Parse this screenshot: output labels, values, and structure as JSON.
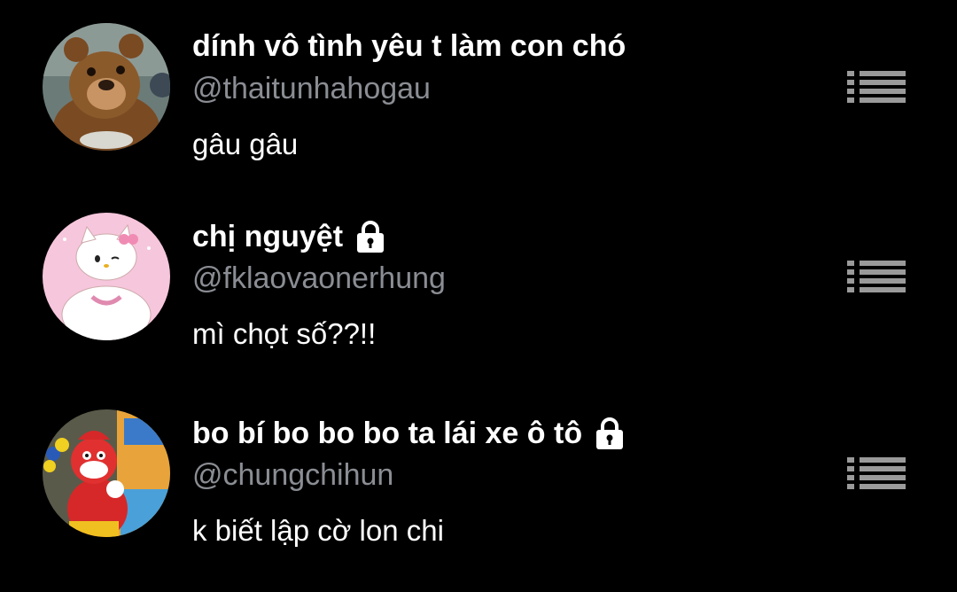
{
  "accounts": [
    {
      "display_name": "dính vô tình yêu t làm con chó",
      "handle": "@thaitunhahogau",
      "bio": "gâu gâu",
      "private": false,
      "avatar": "cartoon-bear-avatar"
    },
    {
      "display_name": "chị nguyệt",
      "handle": "@fklaovaonerhung",
      "bio": "mì chọt số??!!",
      "private": true,
      "avatar": "pink-cat-avatar"
    },
    {
      "display_name": "bo bí bo bo bo ta lái xe ô tô",
      "handle": "@chungchihun",
      "bio": "k biết lập cờ lon chi",
      "private": true,
      "avatar": "mascot-avatar"
    }
  ],
  "colors": {
    "background": "#000000",
    "name": "#ffffff",
    "handle": "#8a8d93",
    "menu_icon": "#9a9a9a"
  }
}
